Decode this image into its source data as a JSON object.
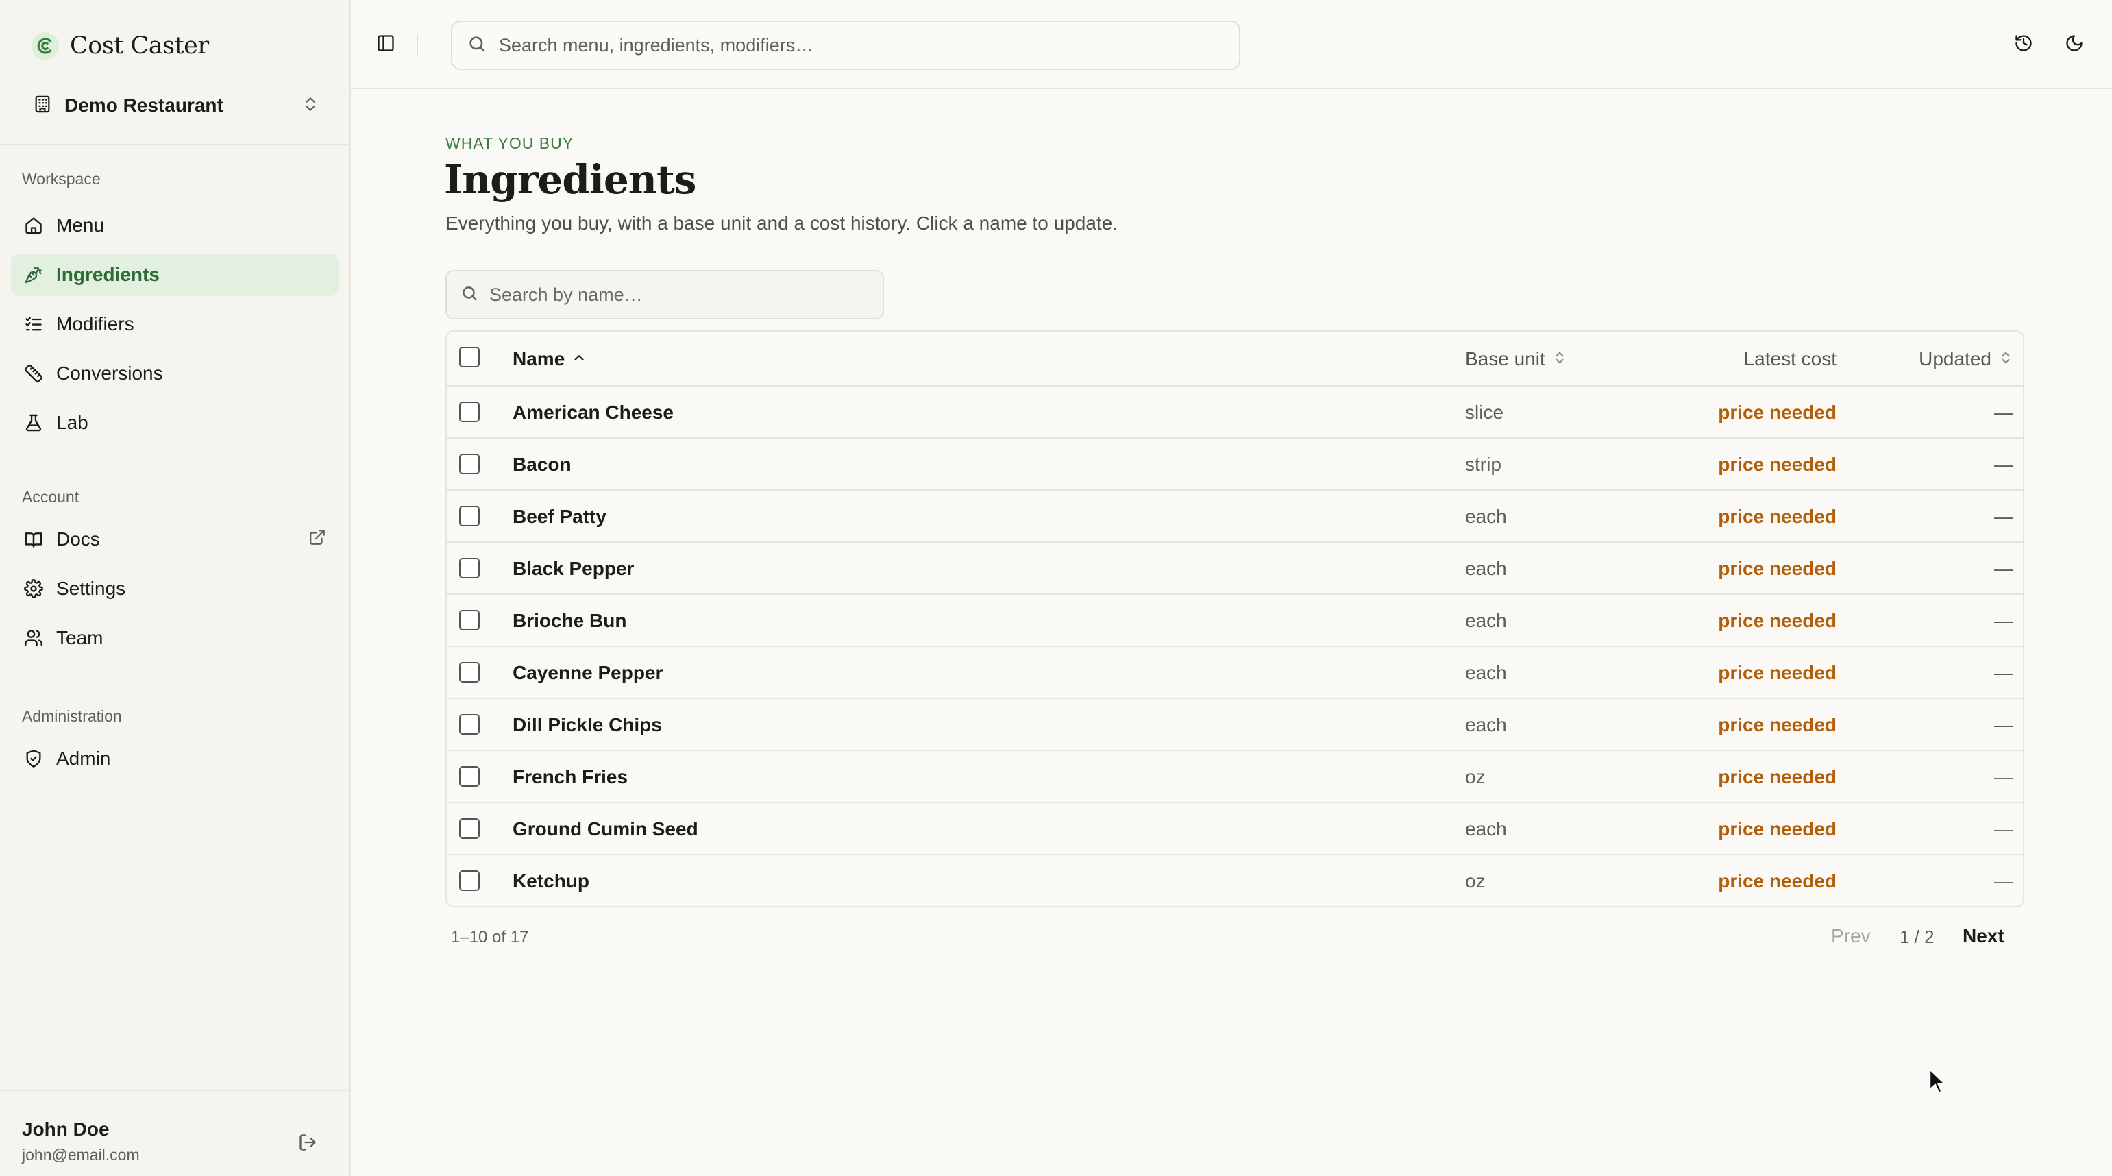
{
  "brand": {
    "name": "Cost Caster"
  },
  "workspace": {
    "name": "Demo Restaurant"
  },
  "sidebar": {
    "sections": [
      {
        "label": "Workspace",
        "items": [
          {
            "label": "Menu",
            "icon": "house-icon"
          },
          {
            "label": "Ingredients",
            "icon": "carrot-icon",
            "active": true
          },
          {
            "label": "Modifiers",
            "icon": "list-checks-icon"
          },
          {
            "label": "Conversions",
            "icon": "ruler-icon"
          },
          {
            "label": "Lab",
            "icon": "flask-icon"
          }
        ]
      },
      {
        "label": "Account",
        "items": [
          {
            "label": "Docs",
            "icon": "book-icon",
            "external": true
          },
          {
            "label": "Settings",
            "icon": "gear-icon"
          },
          {
            "label": "Team",
            "icon": "users-icon"
          }
        ]
      },
      {
        "label": "Administration",
        "items": [
          {
            "label": "Admin",
            "icon": "shield-check-icon"
          }
        ]
      }
    ]
  },
  "user": {
    "name": "John Doe",
    "email": "john@email.com"
  },
  "topbar": {
    "search_placeholder": "Search menu, ingredients, modifiers…"
  },
  "page": {
    "eyebrow": "WHAT YOU BUY",
    "title": "Ingredients",
    "description": "Everything you buy, with a base unit and a cost history. Click a name to update.",
    "filter_placeholder": "Search by name…"
  },
  "table": {
    "columns": {
      "name": "Name",
      "base_unit": "Base unit",
      "latest_cost": "Latest cost",
      "updated": "Updated"
    },
    "rows": [
      {
        "name": "American Cheese",
        "unit": "slice",
        "cost": "price needed",
        "updated": "—"
      },
      {
        "name": "Bacon",
        "unit": "strip",
        "cost": "price needed",
        "updated": "—"
      },
      {
        "name": "Beef Patty",
        "unit": "each",
        "cost": "price needed",
        "updated": "—"
      },
      {
        "name": "Black Pepper",
        "unit": "each",
        "cost": "price needed",
        "updated": "—"
      },
      {
        "name": "Brioche Bun",
        "unit": "each",
        "cost": "price needed",
        "updated": "—"
      },
      {
        "name": "Cayenne Pepper",
        "unit": "each",
        "cost": "price needed",
        "updated": "—"
      },
      {
        "name": "Dill Pickle Chips",
        "unit": "each",
        "cost": "price needed",
        "updated": "—"
      },
      {
        "name": "French Fries",
        "unit": "oz",
        "cost": "price needed",
        "updated": "—"
      },
      {
        "name": "Ground Cumin Seed",
        "unit": "each",
        "cost": "price needed",
        "updated": "—"
      },
      {
        "name": "Ketchup",
        "unit": "oz",
        "cost": "price needed",
        "updated": "—"
      }
    ]
  },
  "pagination": {
    "range": "1–10 of 17",
    "prev": "Prev",
    "page": "1 / 2",
    "next": "Next"
  },
  "colors": {
    "accent": "#3a7d44",
    "active_bg": "#e2f0df",
    "warning": "#b35f0a"
  }
}
